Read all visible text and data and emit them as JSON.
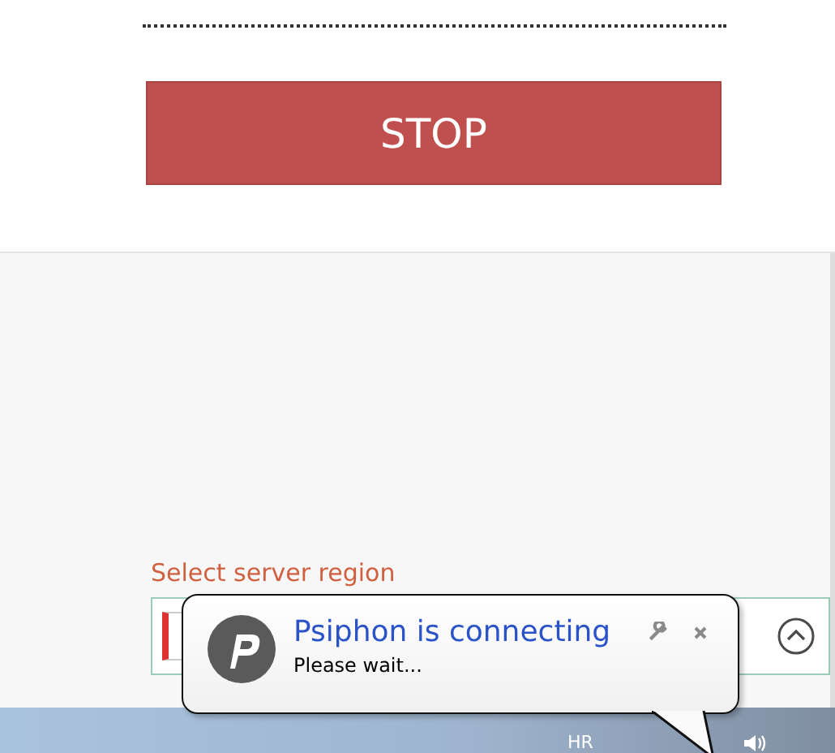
{
  "stop_button": {
    "label": "STOP"
  },
  "server_region": {
    "label": "Select server region"
  },
  "notification": {
    "title": "Psiphon is connecting",
    "message": "Please wait..."
  },
  "taskbar": {
    "language": "HR"
  }
}
